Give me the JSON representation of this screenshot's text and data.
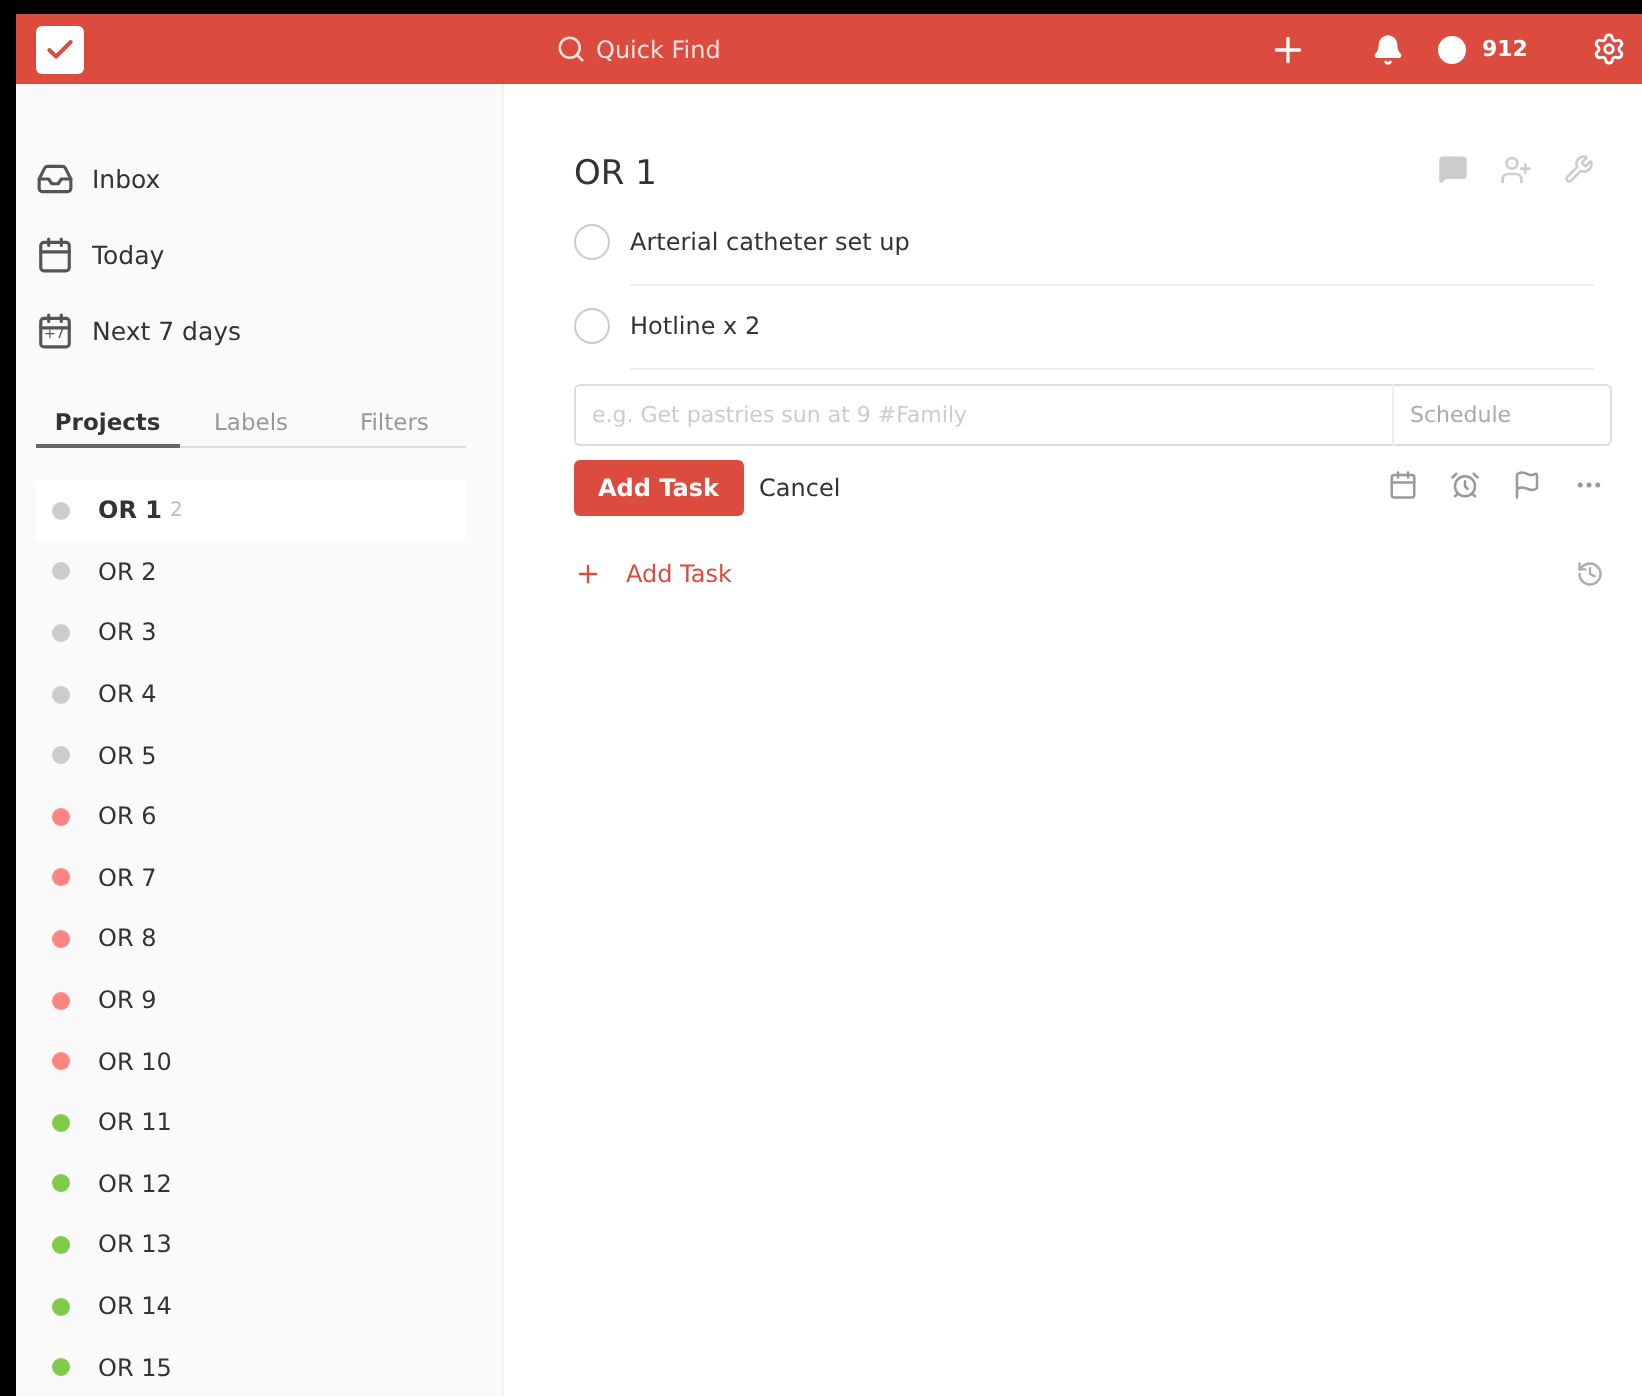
{
  "header": {
    "search": {
      "placeholder": "Quick Find"
    },
    "karma": "912"
  },
  "sidebar": {
    "items": [
      {
        "label": "Inbox",
        "kind": "inbox"
      },
      {
        "label": "Today",
        "kind": "today"
      },
      {
        "label": "Next 7 days",
        "kind": "week",
        "badge": "+7"
      }
    ],
    "tabs": [
      {
        "label": "Projects",
        "selected": true
      },
      {
        "label": "Labels",
        "selected": false
      },
      {
        "label": "Filters",
        "selected": false
      }
    ],
    "projects": [
      {
        "name": "OR 1",
        "count": "2",
        "selected": true,
        "color": "#cccccc"
      },
      {
        "name": "OR 2",
        "selected": false,
        "color": "#cccccc"
      },
      {
        "name": "OR 3",
        "selected": false,
        "color": "#cccccc"
      },
      {
        "name": "OR 4",
        "selected": false,
        "color": "#cccccc"
      },
      {
        "name": "OR 5",
        "selected": false,
        "color": "#cccccc"
      },
      {
        "name": "OR 6",
        "selected": false,
        "color": "#ff8581"
      },
      {
        "name": "OR 7",
        "selected": false,
        "color": "#ff8581"
      },
      {
        "name": "OR 8",
        "selected": false,
        "color": "#ff8581"
      },
      {
        "name": "OR 9",
        "selected": false,
        "color": "#ff8581"
      },
      {
        "name": "OR 10",
        "selected": false,
        "color": "#ff8581"
      },
      {
        "name": "OR 11",
        "selected": false,
        "color": "#7ecc49"
      },
      {
        "name": "OR 12",
        "selected": false,
        "color": "#7ecc49"
      },
      {
        "name": "OR 13",
        "selected": false,
        "color": "#7ecc49"
      },
      {
        "name": "OR 14",
        "selected": false,
        "color": "#7ecc49"
      },
      {
        "name": "OR 15",
        "selected": false,
        "color": "#7ecc49"
      }
    ]
  },
  "main": {
    "title": "OR 1",
    "tasks": [
      {
        "text": "Arterial catheter set up",
        "checked": false
      },
      {
        "text": "Hotline x 2",
        "checked": false
      }
    ],
    "editor": {
      "placeholder": "e.g. Get pastries sun at 9 #Family",
      "schedule_placeholder": "Schedule",
      "submit": "Add Task",
      "cancel": "Cancel"
    },
    "add_task": "Add Task"
  }
}
